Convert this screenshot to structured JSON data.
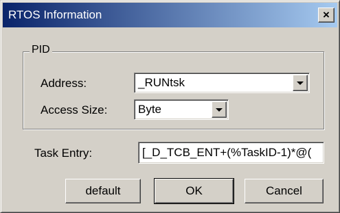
{
  "window": {
    "title": "RTOS Information",
    "close_glyph": "×"
  },
  "pid_group": {
    "legend": "PID",
    "address": {
      "label": "Address:",
      "value": "_RUNtsk"
    },
    "access_size": {
      "label": "Access Size:",
      "value": "Byte"
    }
  },
  "task_entry": {
    "label": "Task Entry:",
    "value": "[_D_TCB_ENT+(%TaskID-1)*@("
  },
  "buttons": {
    "default_label": "default",
    "ok_label": "OK",
    "cancel_label": "Cancel"
  },
  "icons": {
    "dropdown": "chevron-down-icon",
    "close": "close-icon"
  }
}
